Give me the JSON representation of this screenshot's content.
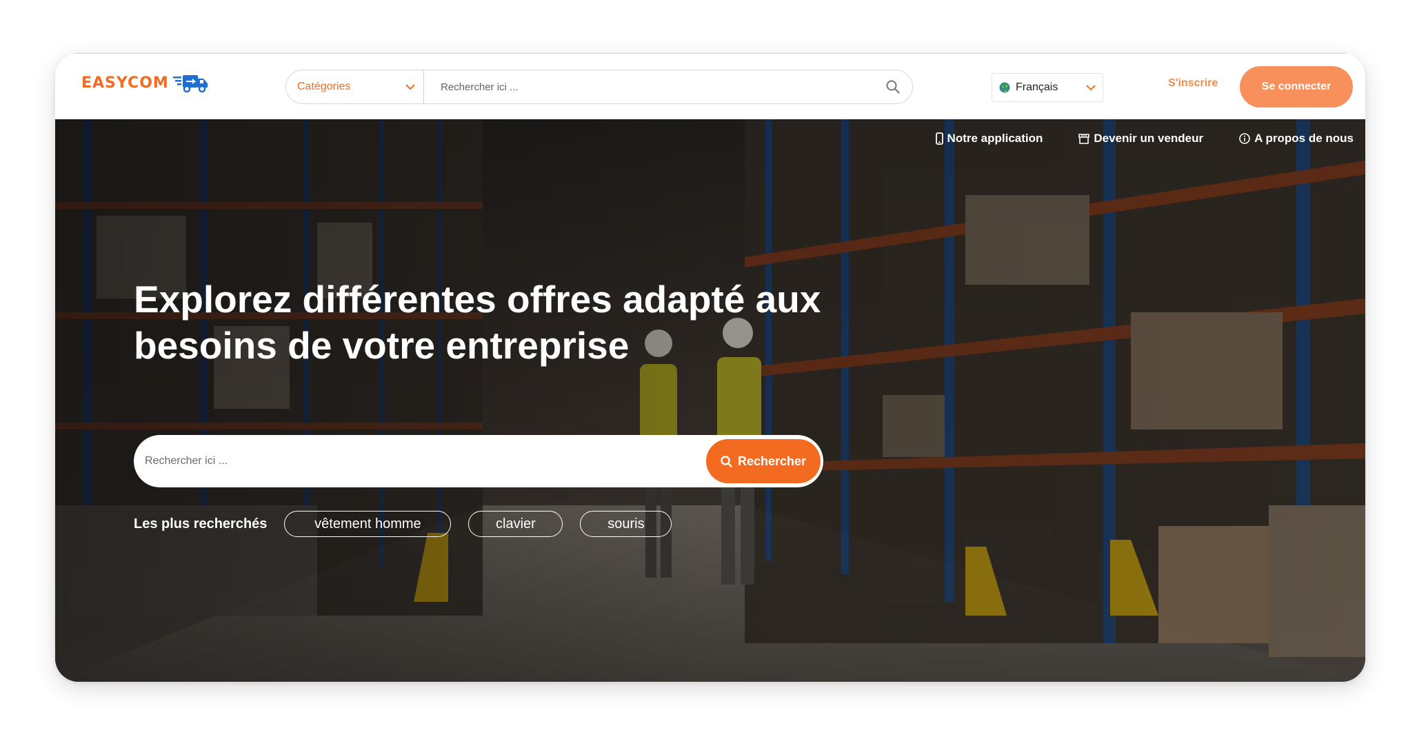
{
  "header": {
    "logo_text": "EASYCOM",
    "categories_label": "Catégories",
    "search_placeholder": "Rechercher ici ...",
    "language": "Français",
    "signup_label": "S'inscrire",
    "login_label": "Se connecter"
  },
  "hero": {
    "links": [
      {
        "icon": "mobile-phone-icon",
        "label": "Notre application"
      },
      {
        "icon": "storefront-icon",
        "label": "Devenir un vendeur"
      },
      {
        "icon": "info-circle-icon",
        "label": "A propos de nous"
      }
    ],
    "headline_line1": "Explorez différentes offres adapté aux",
    "headline_line2": "besoins de votre entreprise",
    "search_placeholder": "Rechercher ici ...",
    "search_button": "Rechercher",
    "popular_label": "Les plus recherchés",
    "popular_tags": [
      "vêtement homme",
      "clavier",
      "souris"
    ]
  },
  "colors": {
    "brand_orange": "#f26b21",
    "login_button": "#f7905a",
    "signup_text": "#f28a4e",
    "logo_blue": "#1d6fd1"
  }
}
